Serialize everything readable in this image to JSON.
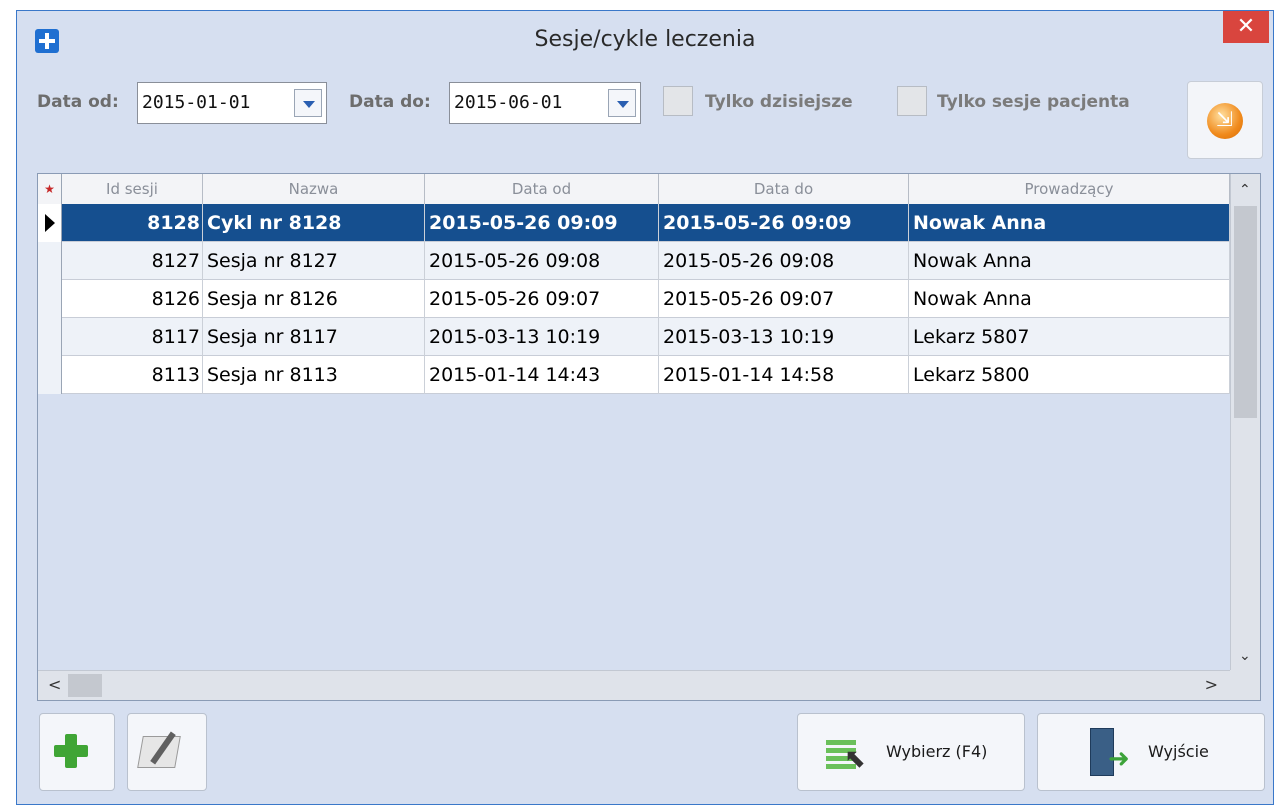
{
  "window": {
    "title": "Sesje/cykle leczenia",
    "close_glyph": "✕"
  },
  "filters": {
    "date_from_label": "Data od:",
    "date_from_value": "2015-01-01",
    "date_to_label": "Data do:",
    "date_to_value": "2015-06-01",
    "only_today_label": "Tylko dzisiejsze",
    "only_today_checked": false,
    "only_patient_label": "Tylko sesje pacjenta",
    "only_patient_checked": false
  },
  "grid": {
    "columns": [
      "Id sesji",
      "Nazwa",
      "Data od",
      "Data do",
      "Prowadzący"
    ],
    "rows": [
      {
        "id": "8128",
        "name": "Cykl nr 8128",
        "from": "2015-05-26 09:09",
        "to": "2015-05-26 09:09",
        "lead": "Nowak Anna",
        "selected": true
      },
      {
        "id": "8127",
        "name": "Sesja nr 8127",
        "from": "2015-05-26 09:08",
        "to": "2015-05-26 09:08",
        "lead": "Nowak Anna",
        "selected": false
      },
      {
        "id": "8126",
        "name": "Sesja nr 8126",
        "from": "2015-05-26 09:07",
        "to": "2015-05-26 09:07",
        "lead": "Nowak Anna",
        "selected": false
      },
      {
        "id": "8117",
        "name": "Sesja nr 8117",
        "from": "2015-03-13 10:19",
        "to": "2015-03-13 10:19",
        "lead": "Lekarz 5807",
        "selected": false
      },
      {
        "id": "8113",
        "name": "Sesja nr 8113",
        "from": "2015-01-14 14:43",
        "to": "2015-01-14 14:58",
        "lead": "Lekarz 5800",
        "selected": false
      }
    ]
  },
  "buttons": {
    "select_label": "Wybierz (F4)",
    "exit_label": "Wyjście"
  },
  "icons": {
    "app": "medical-cross-icon",
    "refresh": "refresh-icon",
    "add": "plus-icon",
    "edit": "edit-icon",
    "select": "select-icon",
    "exit": "exit-door-icon"
  }
}
